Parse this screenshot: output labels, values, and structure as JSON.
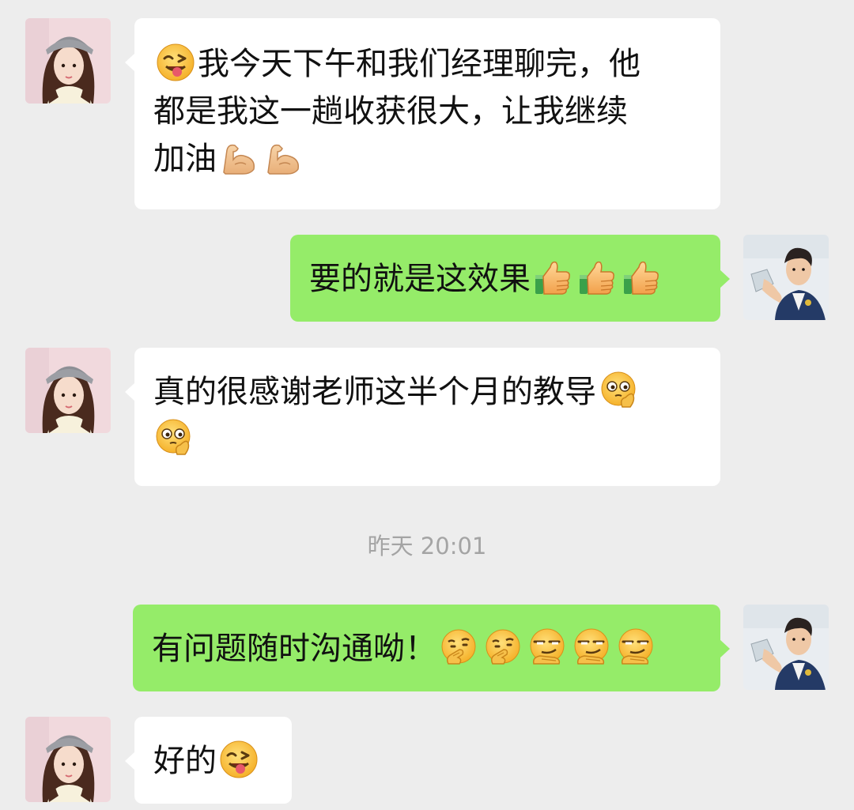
{
  "messages": [
    {
      "side": "in",
      "text_lines": [
        "我今天下午和我们经理聊完，他",
        "都是我这一趟收获很大，让我继续",
        "加油"
      ],
      "leading_emoji": "winking-tongue-face",
      "trailing_emojis": [
        "flexed-biceps",
        "flexed-biceps"
      ]
    },
    {
      "side": "out",
      "text": "要的就是这效果",
      "trailing_emojis": [
        "thumbs-up",
        "thumbs-up",
        "thumbs-up"
      ]
    },
    {
      "side": "in",
      "text": "真的很感谢老师这半个月的教导",
      "trailing_emojis": [
        "pleading-face-hand",
        "pleading-face-hand"
      ]
    },
    {
      "side": "out",
      "text": "有问题随时沟通呦！",
      "trailing_emojis": [
        "thinking-hand-face",
        "thinking-hand-face",
        "smirking-hand-face",
        "smirking-hand-face",
        "smirking-hand-face"
      ]
    },
    {
      "side": "in",
      "text": "好的",
      "trailing_emojis": [
        "winking-tongue-face"
      ]
    }
  ],
  "timestamp": "昨天 20:01",
  "colors": {
    "background": "#ededed",
    "incoming_bubble": "#ffffff",
    "outgoing_bubble": "#95ec69",
    "timestamp_text": "#a4a4a4"
  },
  "avatars": {
    "contact": "contact-avatar-woman-beanie",
    "self": "self-avatar-man-suit"
  }
}
